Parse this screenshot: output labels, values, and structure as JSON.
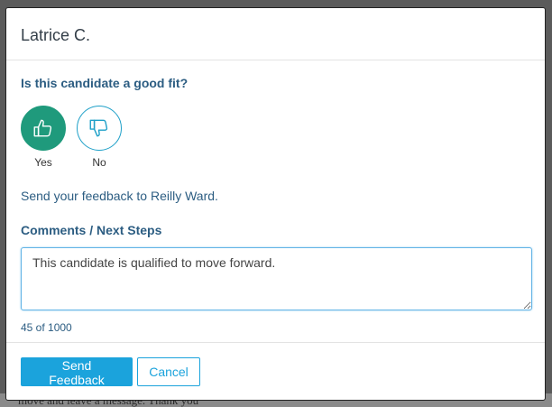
{
  "modal": {
    "title": "Latrice C.",
    "question": "Is this candidate a good fit?",
    "choices": [
      {
        "label": "Yes",
        "icon": "thumbs-up-icon",
        "selected": true
      },
      {
        "label": "No",
        "icon": "thumbs-down-icon",
        "selected": false
      }
    ],
    "send_to": "Send your feedback to Reilly Ward.",
    "comments_label": "Comments / Next Steps",
    "comments_value": "This candidate is qualified to move forward.",
    "char_count": "45 of 1000",
    "send_button": "Send Feedback",
    "cancel_button": "Cancel"
  },
  "background": {
    "partial_text": "move and leave a message. Thank you"
  },
  "colors": {
    "selected": "#1f9a7c",
    "accent": "#1ba3dc",
    "heading": "#2c5d82"
  }
}
